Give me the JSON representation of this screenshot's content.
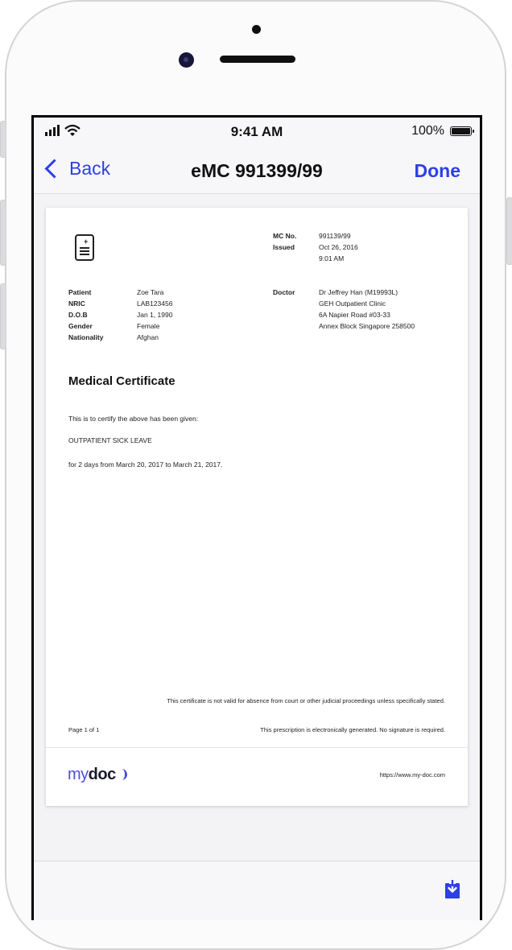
{
  "status_bar": {
    "time": "9:41 AM",
    "battery": "100%"
  },
  "nav": {
    "back_label": "Back",
    "title": "eMC 991399/99",
    "done_label": "Done"
  },
  "certificate": {
    "mc_no_label": "MC No.",
    "mc_no": "991139/99",
    "issued_label": "Issued",
    "issued_date": "Oct 26, 2016",
    "issued_time": "9:01 AM",
    "patient": {
      "fields": [
        {
          "label": "Patient",
          "value": "Zoe Tara"
        },
        {
          "label": "NRIC",
          "value": "LAB123456"
        },
        {
          "label": "D.O.B",
          "value": "Jan 1, 1990"
        },
        {
          "label": "Gender",
          "value": "Female"
        },
        {
          "label": "Nationality",
          "value": "Afghan"
        }
      ]
    },
    "doctor": {
      "label": "Doctor",
      "lines": [
        "Dr Jeffrey Han (M19993L)",
        "GEH Outpatient Clinic",
        "6A Napier Road #03-33",
        "Annex Block Singapore 258500"
      ]
    },
    "heading": "Medical Certificate",
    "certify_text": "This is to certify the above has been given:",
    "leave_type": "OUTPATIENT SICK LEAVE",
    "duration_text": "for 2 days from March 20, 2017 to March 21, 2017.",
    "validity_note": "This certificate is not valid for absence from court or other judicial proceedings unless specifically stated.",
    "page_number": "Page 1 of 1",
    "electronic_note": "This prescription is electronically generated. No signature is required.",
    "brand_my": "my",
    "brand_doc": "doc",
    "website": "https://www.my-doc.com"
  },
  "icons": {
    "certificate": "document-certificate-icon",
    "share": "download-share-icon",
    "back": "chevron-left-icon"
  },
  "colors": {
    "accent": "#2d40e4",
    "brand": "#4b4fd8"
  }
}
